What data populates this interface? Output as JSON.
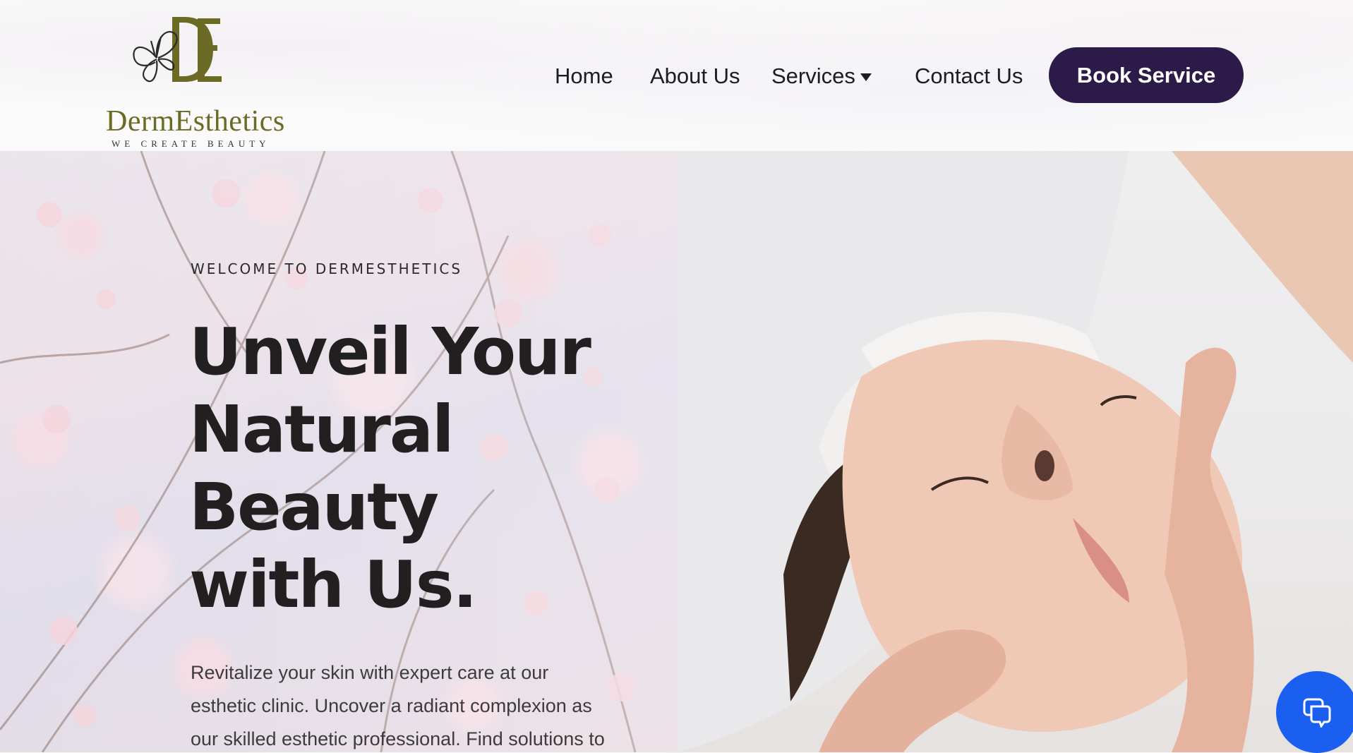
{
  "brand": {
    "monogram": "DE",
    "name": "DermEsthetics",
    "tagline": "WE CREATE BEAUTY",
    "colors": {
      "olive": "#6b6b26",
      "accent": "#2c1a48",
      "chat": "#1b5ff0"
    }
  },
  "nav": {
    "items": [
      {
        "label": "Home"
      },
      {
        "label": "About Us"
      },
      {
        "label": "Services",
        "has_dropdown": true
      },
      {
        "label": "Contact Us"
      }
    ],
    "cta_label": "Book Service"
  },
  "hero": {
    "eyebrow": "WELCOME TO DERMESTHETICS",
    "headline": "Unveil Your Natural Beauty with Us.",
    "description": "Revitalize your skin with expert care at our esthetic clinic. Uncover a radiant complexion as our skilled esthetic professional. Find solutions to your unique",
    "left_image": "cherry-blossom-branches",
    "right_image": "woman-receiving-facial-massage"
  },
  "chat": {
    "icon": "chat-icon"
  }
}
